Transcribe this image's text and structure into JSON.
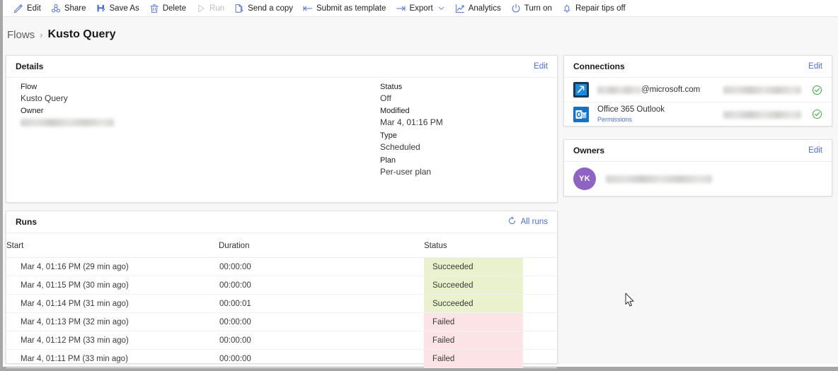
{
  "toolbar": {
    "items": [
      {
        "label": "Edit",
        "icon": "pencil-icon",
        "disabled": false
      },
      {
        "label": "Share",
        "icon": "share-icon",
        "disabled": false
      },
      {
        "label": "Save As",
        "icon": "save-as-icon",
        "disabled": false
      },
      {
        "label": "Delete",
        "icon": "trash-icon",
        "disabled": false
      },
      {
        "label": "Run",
        "icon": "play-icon",
        "disabled": true
      },
      {
        "label": "Send a copy",
        "icon": "copy-icon",
        "disabled": false
      },
      {
        "label": "Submit as template",
        "icon": "arrow-left-icon",
        "disabled": false
      },
      {
        "label": "Export",
        "icon": "arrow-right-icon",
        "disabled": false,
        "chevron": true
      },
      {
        "label": "Analytics",
        "icon": "chart-line-icon",
        "disabled": false
      },
      {
        "label": "Turn on",
        "icon": "power-icon",
        "disabled": false
      },
      {
        "label": "Repair tips off",
        "icon": "bell-icon",
        "disabled": false
      }
    ]
  },
  "breadcrumb": {
    "root": "Flows",
    "separator": "›",
    "current": "Kusto Query"
  },
  "details": {
    "title": "Details",
    "edit_label": "Edit",
    "fields": [
      {
        "label": "Flow",
        "value": "Kusto Query",
        "redacted": false
      },
      {
        "label": "Owner",
        "value": "",
        "redacted": true,
        "redact_width": 132
      },
      {
        "label": "Status",
        "value": "Off",
        "redacted": false
      },
      {
        "label": "Modified",
        "value": "Mar 4, 01:16 PM",
        "redacted": false
      },
      {
        "label": "Type",
        "value": "Scheduled",
        "redacted": false
      },
      {
        "label": "Plan",
        "value": "Per-user plan",
        "redacted": false
      }
    ]
  },
  "connections": {
    "title": "Connections",
    "edit_label": "Edit",
    "rows": [
      {
        "icon": "azure-data-explorer-icon",
        "name_prefix": "",
        "name_suffix": "@microsoft.com",
        "name_redacted": true,
        "name_redact_width": 62,
        "sub_label": "",
        "account_redacted": true,
        "status_icon": "check-circle-icon"
      },
      {
        "icon": "office365-outlook-icon",
        "name_prefix": "Office 365 Outlook",
        "name_suffix": "",
        "name_redacted": false,
        "sub_label": "Permissions",
        "account_redacted": true,
        "status_icon": "check-circle-icon"
      }
    ]
  },
  "owners": {
    "title": "Owners",
    "edit_label": "Edit",
    "rows": [
      {
        "initials": "YK",
        "name": "",
        "redacted": true,
        "redact_width": 150
      }
    ]
  },
  "runs": {
    "title": "Runs",
    "refresh_icon": "refresh-icon",
    "all_runs_label": "All runs",
    "columns": [
      "Start",
      "Duration",
      "Status"
    ],
    "rows": [
      {
        "start": "Mar 4, 01:16 PM (29 min ago)",
        "duration": "00:00:00",
        "status": "Succeeded"
      },
      {
        "start": "Mar 4, 01:15 PM (30 min ago)",
        "duration": "00:00:00",
        "status": "Succeeded"
      },
      {
        "start": "Mar 4, 01:14 PM (31 min ago)",
        "duration": "00:00:01",
        "status": "Succeeded"
      },
      {
        "start": "Mar 4, 01:13 PM (32 min ago)",
        "duration": "00:00:00",
        "status": "Failed"
      },
      {
        "start": "Mar 4, 01:12 PM (33 min ago)",
        "duration": "00:00:00",
        "status": "Failed"
      },
      {
        "start": "Mar 4, 01:11 PM (33 min ago)",
        "duration": "00:00:00",
        "status": "Failed"
      }
    ]
  },
  "colors": {
    "link": "#4a6fd4",
    "succeeded_bg": "#eaf2cd",
    "failed_bg": "#fbe3e6",
    "check_green": "#3eaa3e",
    "avatar_purple": "#8e63c4",
    "page_bg": "#f7f7f7"
  }
}
